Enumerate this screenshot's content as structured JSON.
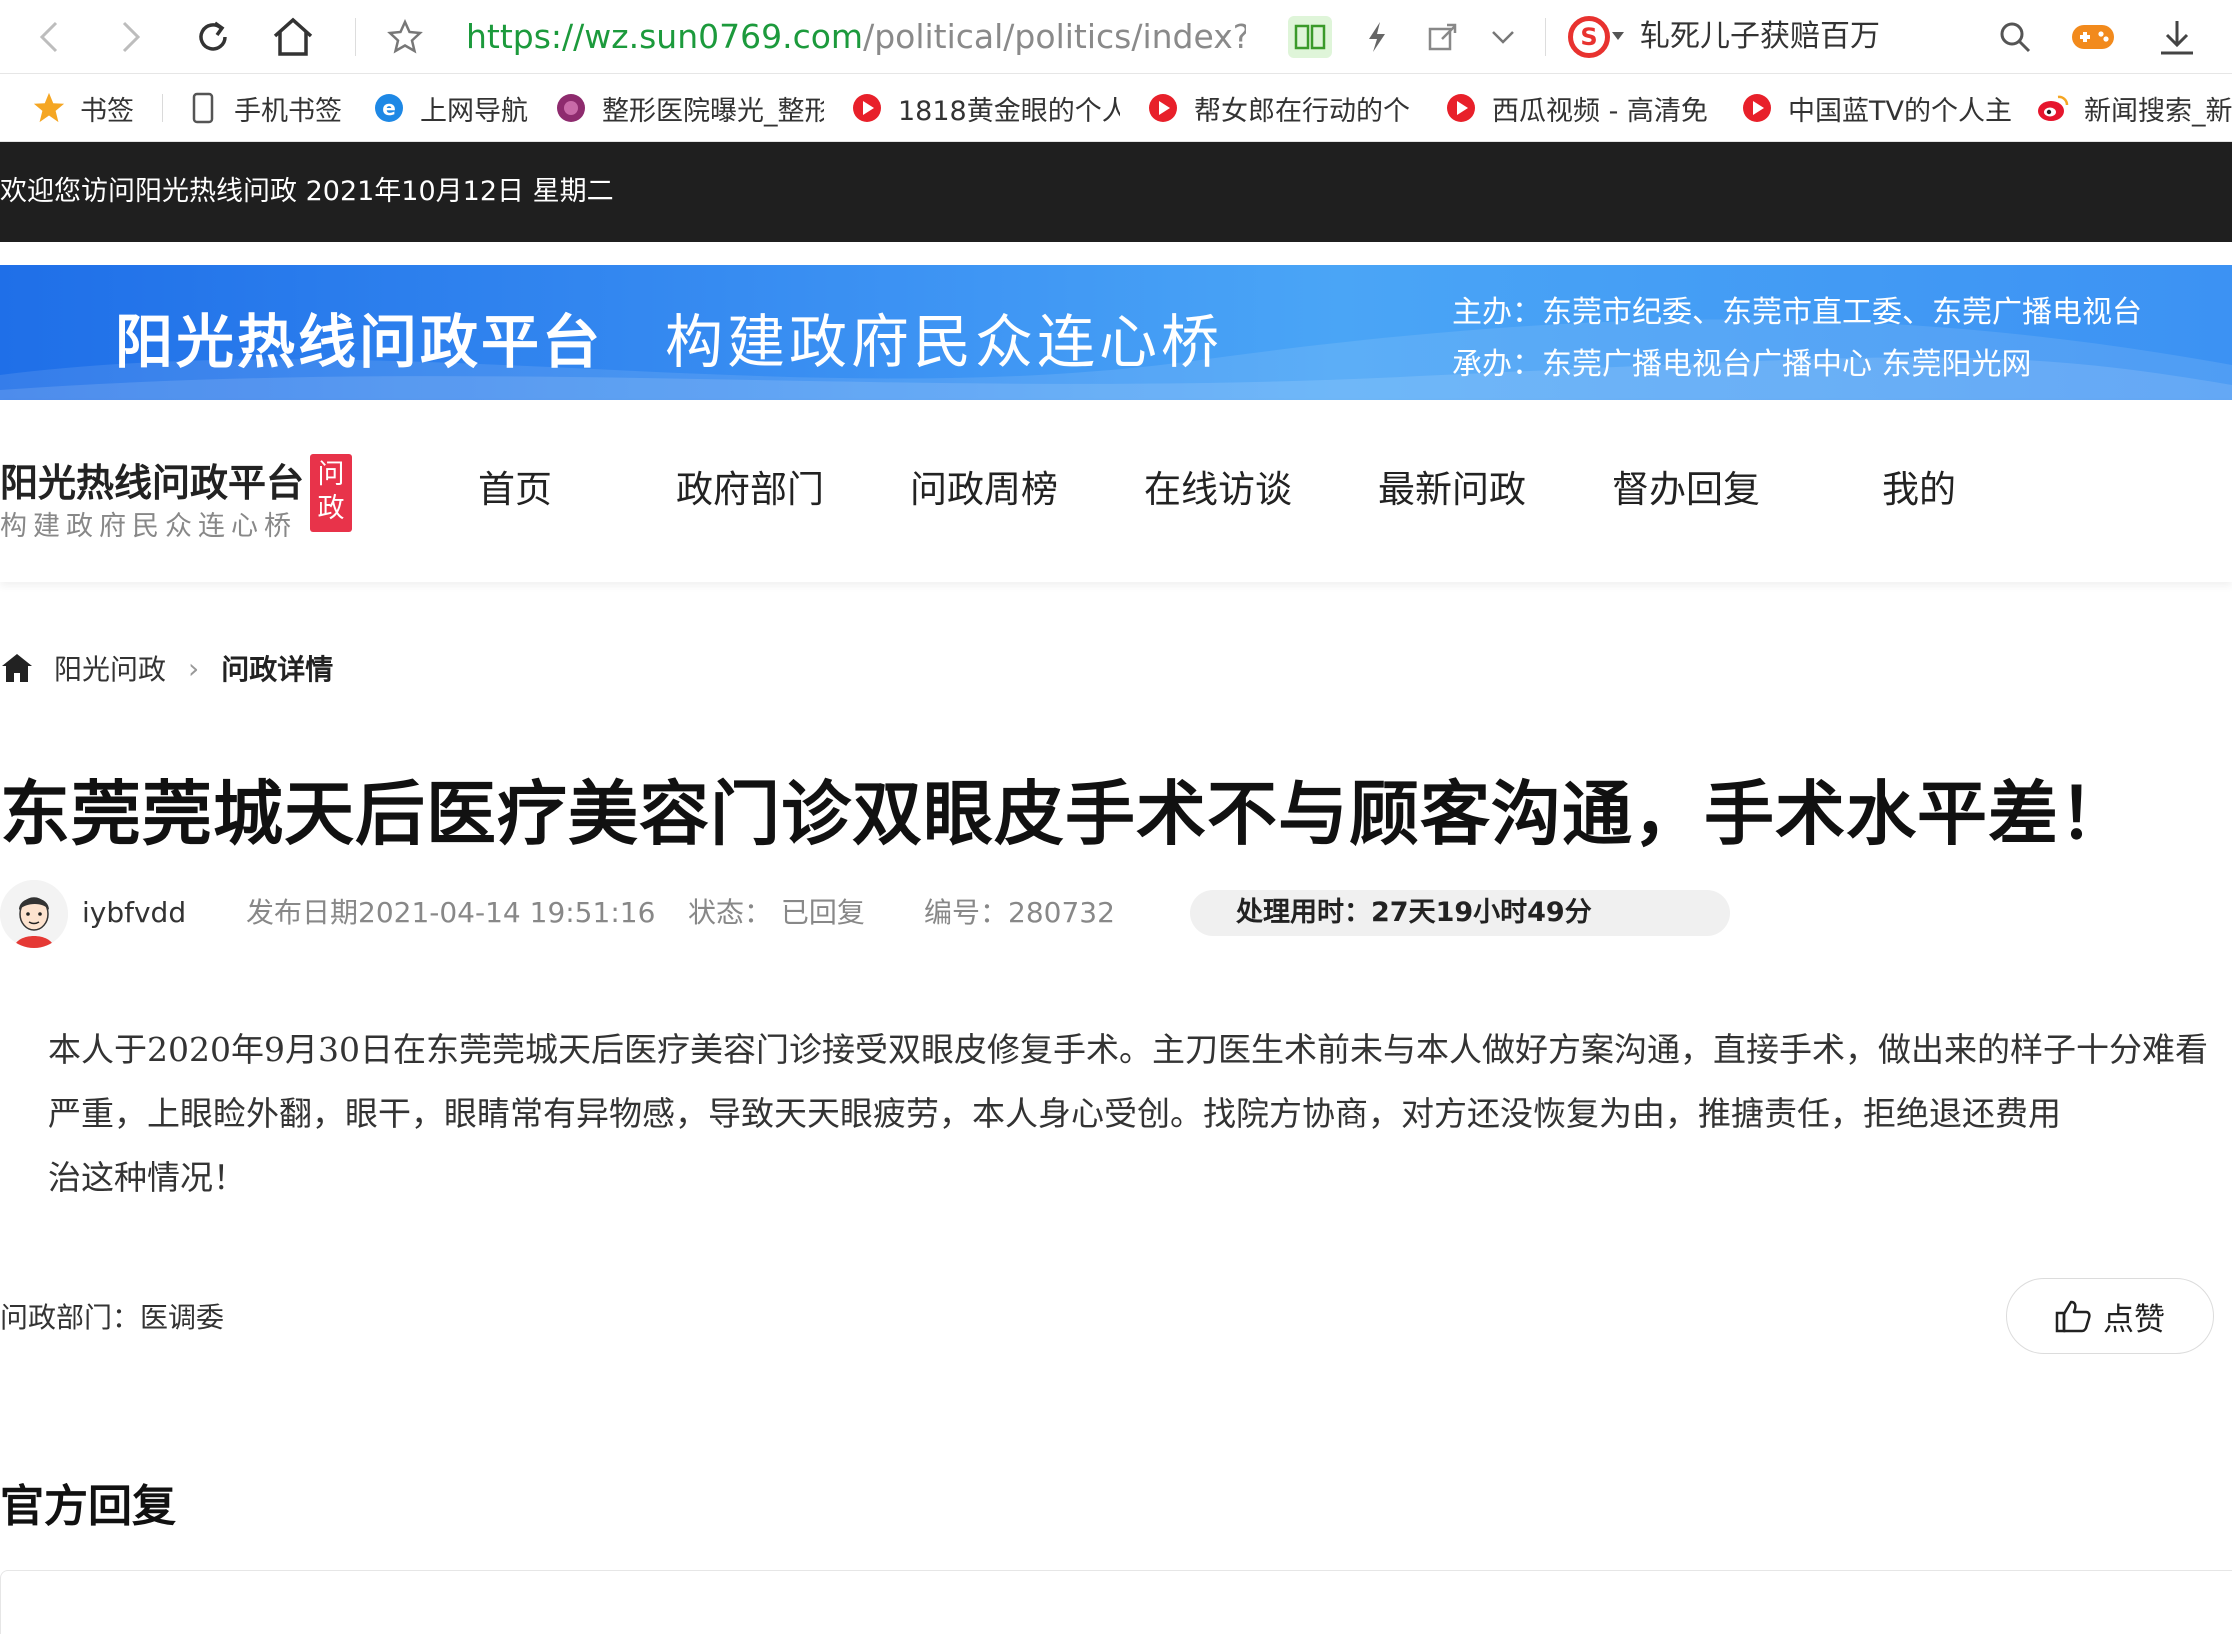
{
  "browser": {
    "url_host": "https://wz.sun0769.com",
    "url_path": "/political/politics/index?id=",
    "hot_search": "轧死儿子获赔百万"
  },
  "bookmarks": [
    {
      "label": "书签",
      "icon": "star-icon"
    },
    {
      "label": "手机书签",
      "icon": "phone-icon"
    },
    {
      "label": "上网导航",
      "icon": "ie-icon"
    },
    {
      "label": "整形医院曝光_整形",
      "icon": "hospital-icon"
    },
    {
      "label": "1818黄金眼的个人",
      "icon": "video-play-icon"
    },
    {
      "label": "帮女郎在行动的个",
      "icon": "video-play-icon"
    },
    {
      "label": "西瓜视频 - 高清免",
      "icon": "video-play-icon"
    },
    {
      "label": "中国蓝TV的个人主",
      "icon": "video-play-icon"
    },
    {
      "label": "新闻搜索_新",
      "icon": "weibo-icon"
    }
  ],
  "welcome": "欢迎您访问阳光热线问政  2021年10月12日  星期二",
  "banner": {
    "title": "阳光热线问政平台",
    "slogan": "构建政府民众连心桥",
    "host": "主办：东莞市纪委、东莞市直工委、东莞广播电视台",
    "co": "承办：东莞广播电视台广播中心 东莞阳光网"
  },
  "logo": {
    "main": "阳光热线问政平台",
    "sub": "构建政府民众连心桥",
    "badge_top": "问",
    "badge_bottom": "政"
  },
  "nav": [
    "首页",
    "政府部门",
    "问政周榜",
    "在线访谈",
    "最新问政",
    "督办回复",
    "我的"
  ],
  "breadcrumb": {
    "home": "阳光问政",
    "separator": "›",
    "current": "问政详情"
  },
  "article": {
    "title": "东莞莞城天后医疗美容门诊双眼皮手术不与顾客沟通，手术水平差！",
    "author": "iybfvdd",
    "publish": "发布日期2021-04-14 19:51:16",
    "status": "状态：  已回复",
    "number": "编号：280732",
    "time_used": "处理用时：27天19小时49分",
    "body": [
      "本人于2020年9月30日在东莞莞城天后医疗美容门诊接受双眼皮修复手术。主刀医生术前未与本人做好方案沟通，直接手术，做出来的样子十分难看",
      "严重，上眼睑外翻，眼干，眼睛常有异物感，导致天天眼疲劳，本人身心受创。找院方协商，对方还没恢复为由，推搪责任，拒绝退还费用",
      "治这种情况！"
    ],
    "department": "问政部门：医调委",
    "like_label": "点赞"
  },
  "reply": {
    "title": "官方回复"
  },
  "colors": {
    "welcome_bg": "#1f1f1f",
    "banner_blue": "#3c92f3",
    "badge_red": "#e8334a",
    "url_green": "#1c9a3c"
  }
}
